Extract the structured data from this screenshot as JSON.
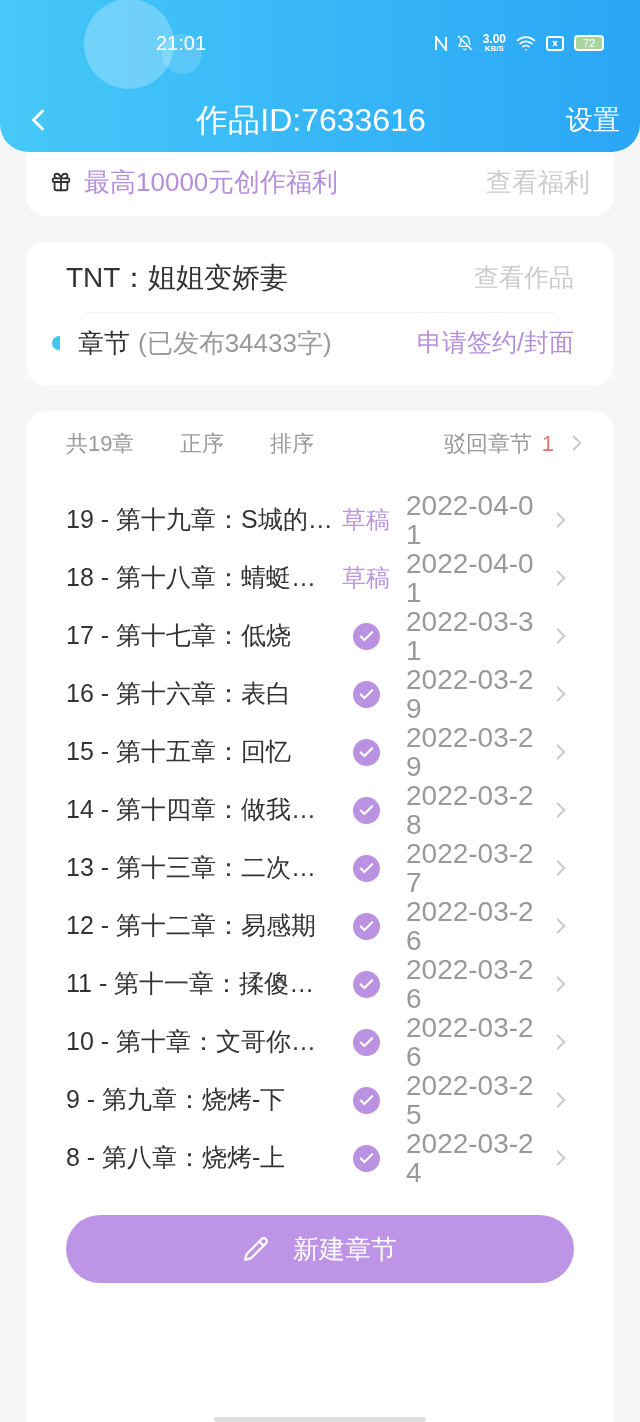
{
  "status_bar": {
    "time": "21:01",
    "speed": "3.00",
    "speed_unit": "KB/S",
    "battery": "72"
  },
  "header": {
    "title": "作品ID:7633616",
    "settings": "设置"
  },
  "benefit": {
    "text": "最高10000元创作福利",
    "link": "查看福利"
  },
  "work": {
    "title": "TNT：姐姐变娇妻",
    "link": "查看作品",
    "section": "章节",
    "published": "(已发布34433字)",
    "action": "申请签约/封面"
  },
  "toolbar": {
    "count": "共19章",
    "order": "正序",
    "sort": "排序",
    "rejected": "驳回章节",
    "rejected_count": "1"
  },
  "chapters": [
    {
      "title": "19 - 第十九章：S城的…",
      "kind": "draft",
      "label": "草稿",
      "date": "2022-04-01"
    },
    {
      "title": "18 - 第十八章：蜻蜓…",
      "kind": "draft",
      "label": "草稿",
      "date": "2022-04-01"
    },
    {
      "title": "17 - 第十七章：低烧",
      "kind": "published",
      "date": "2022-03-31"
    },
    {
      "title": "16 - 第十六章：表白",
      "kind": "published",
      "date": "2022-03-29"
    },
    {
      "title": "15 - 第十五章：回忆",
      "kind": "published",
      "date": "2022-03-29"
    },
    {
      "title": "14 - 第十四章：做我…",
      "kind": "published",
      "date": "2022-03-28"
    },
    {
      "title": "13 - 第十三章：二次…",
      "kind": "published",
      "date": "2022-03-27"
    },
    {
      "title": "12 - 第十二章：易感期",
      "kind": "published",
      "date": "2022-03-26"
    },
    {
      "title": "11 - 第十一章：揉傻…",
      "kind": "published",
      "date": "2022-03-26"
    },
    {
      "title": "10 - 第十章：文哥你…",
      "kind": "published",
      "date": "2022-03-26"
    },
    {
      "title": "9 - 第九章：烧烤-下",
      "kind": "published",
      "date": "2022-03-25"
    },
    {
      "title": "8 - 第八章：烧烤-上",
      "kind": "published",
      "date": "2022-03-24"
    }
  ],
  "new_chapter_button": "新建章节"
}
